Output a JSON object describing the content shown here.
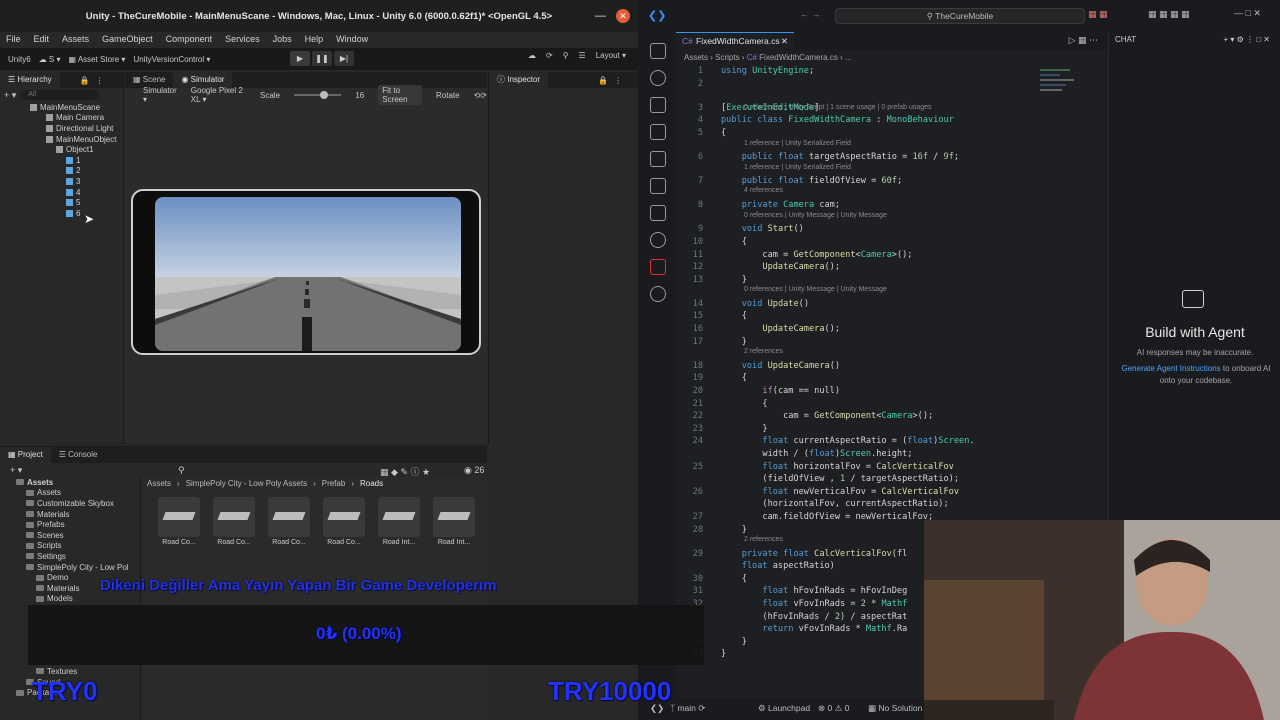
{
  "unity": {
    "title": "Unity - TheCureMobile - MainMenuScane - Windows, Mac, Linux - Unity 6.0 (6000.0.62f1)* <OpenGL 4.5>",
    "menu": [
      "File",
      "Edit",
      "Assets",
      "GameObject",
      "Component",
      "Services",
      "Jobs",
      "Help",
      "Window"
    ],
    "toolbar": {
      "account": "Unity6",
      "asset_store": "Asset Store",
      "version_control": "UnityVersionControl",
      "layout": "Layout"
    },
    "hierarchy": {
      "tab": "Hierarchy",
      "search_placeholder": "All",
      "items": [
        {
          "label": "MainMenuScane",
          "indent": 1
        },
        {
          "label": "Main Camera",
          "indent": 2
        },
        {
          "label": "Directional Light",
          "indent": 2
        },
        {
          "label": "MainMenuObject",
          "indent": 2
        },
        {
          "label": "Object1",
          "indent": 3
        },
        {
          "label": "1",
          "indent": 4
        },
        {
          "label": "2",
          "indent": 4
        },
        {
          "label": "3",
          "indent": 4
        },
        {
          "label": "4",
          "indent": 4
        },
        {
          "label": "5",
          "indent": 4
        },
        {
          "label": "6",
          "indent": 4
        }
      ]
    },
    "view_tabs": [
      "Scene",
      "Simulator"
    ],
    "simulator": {
      "mode": "Simulator",
      "device": "Google Pixel 2 XL",
      "scale_label": "Scale",
      "scale_value": "16",
      "fit_label": "Fit to Screen",
      "rotate_label": "Rotate"
    },
    "inspector": {
      "tab": "Inspector"
    },
    "project": {
      "tabs": [
        "Project",
        "Console"
      ],
      "count": "26",
      "tree": [
        {
          "label": "Assets",
          "indent": 0
        },
        {
          "label": "Assets",
          "indent": 1
        },
        {
          "label": "Customizable Skybox",
          "indent": 1
        },
        {
          "label": "Materials",
          "indent": 1
        },
        {
          "label": "Prefabs",
          "indent": 1
        },
        {
          "label": "Scenes",
          "indent": 1
        },
        {
          "label": "Scripts",
          "indent": 1
        },
        {
          "label": "Settings",
          "indent": 1
        },
        {
          "label": "SimplePoly City - Low Pol",
          "indent": 1
        },
        {
          "label": "Demo",
          "indent": 2
        },
        {
          "label": "Materials",
          "indent": 2
        },
        {
          "label": "Models",
          "indent": 2
        }
      ],
      "tree_bottom": [
        "Textures",
        "Sound",
        "Packages"
      ],
      "breadcrumb": [
        "Assets",
        "SimplePoly City - Low Poly Assets",
        "Prefab",
        "Roads"
      ],
      "assets": [
        "Road Co...",
        "Road Co...",
        "Road Co...",
        "Road Co...",
        "Road Int...",
        "Road Int..."
      ]
    }
  },
  "vscode": {
    "search": "TheCureMobile",
    "tab": "FixedWidthCamera.cs",
    "breadcrumb": [
      "Assets",
      "Scripts",
      "FixedWidthCamera.cs",
      "..."
    ],
    "code": [
      {
        "n": "1",
        "t": "using UnityEngine;"
      },
      {
        "n": "2",
        "t": ""
      },
      {
        "n": "3",
        "t": "[ExecuteInEditMode]"
      },
      {
        "n": "4",
        "t": "public class FixedWidthCamera : MonoBehaviour"
      },
      {
        "n": "5",
        "t": "{"
      },
      {
        "n": "6",
        "t": "    public float targetAspectRatio = 16f / 9f;"
      },
      {
        "n": "7",
        "t": "    public float fieldOfView = 60f;"
      },
      {
        "n": "8",
        "t": "    private Camera cam;"
      },
      {
        "n": "9",
        "t": "    void Start()"
      },
      {
        "n": "10",
        "t": "    {"
      },
      {
        "n": "11",
        "t": "        cam = GetComponent<Camera>();"
      },
      {
        "n": "12",
        "t": "        UpdateCamera();"
      },
      {
        "n": "13",
        "t": "    }"
      },
      {
        "n": "14",
        "t": "    void Update()"
      },
      {
        "n": "15",
        "t": "    {"
      },
      {
        "n": "16",
        "t": "        UpdateCamera();"
      },
      {
        "n": "17",
        "t": "    }"
      },
      {
        "n": "18",
        "t": "    void UpdateCamera()"
      },
      {
        "n": "19",
        "t": "    {"
      },
      {
        "n": "20",
        "t": "        if(cam == null)"
      },
      {
        "n": "21",
        "t": "        {"
      },
      {
        "n": "22",
        "t": "            cam = GetComponent<Camera>();"
      },
      {
        "n": "23",
        "t": "        }"
      },
      {
        "n": "24",
        "t": "        float currentAspectRatio = (float)Screen."
      },
      {
        "n": "",
        "t": "        width / (float)Screen.height;"
      },
      {
        "n": "25",
        "t": "        float horizontalFov = CalcVerticalFov"
      },
      {
        "n": "",
        "t": "        (fieldOfView , 1 / targetAspectRatio);"
      },
      {
        "n": "26",
        "t": "        float newVerticalFov = CalcVerticalFov"
      },
      {
        "n": "",
        "t": "        (horizontalFov, currentAspectRatio);"
      },
      {
        "n": "27",
        "t": "        cam.fieldOfView = newVerticalFov;"
      },
      {
        "n": "28",
        "t": "    }"
      },
      {
        "n": "29",
        "t": "    private float CalcVerticalFov(fl"
      },
      {
        "n": "",
        "t": "    float aspectRatio)"
      },
      {
        "n": "30",
        "t": "    {"
      },
      {
        "n": "31",
        "t": "        float hFovInRads = hFovInDeg"
      },
      {
        "n": "32",
        "t": "        float vFovInRads = 2 * Mathf"
      },
      {
        "n": "",
        "t": "        (hFovInRads / 2) / aspectRat"
      },
      {
        "n": "",
        "t": "        return vFovInRads * Mathf.Ra"
      },
      {
        "n": "33",
        "t": "    }"
      },
      {
        "n": "34",
        "t": "}"
      }
    ],
    "lenses": [
      "0 references | Unity Script | 1 scene usage | 0 prefab usages",
      "1 reference | Unity Serialized Field",
      "1 reference | Unity Serialized Field",
      "4 references",
      "0 references | Unity Message | Unity Message",
      "0 references | Unity Message | Unity Message",
      "2 references",
      "2 references"
    ],
    "chat": {
      "header": "CHAT",
      "title": "Build with Agent",
      "note": "AI responses may be inaccurate.",
      "link": "Generate Agent Instructions",
      "link_rest": "to onboard AI onto your codebase."
    },
    "status": {
      "branch": "main",
      "launchpad": "Launchpad",
      "errors": "0",
      "warnings": "0",
      "solution": "No Solution"
    }
  },
  "overlays": {
    "ticker": "Dikeni Değiller Ama Yayın Yapan Bir Game Developerım",
    "progress": "0₺ (0.00%)",
    "left_amount": "TRY0",
    "right_amount": "TRY10000"
  }
}
